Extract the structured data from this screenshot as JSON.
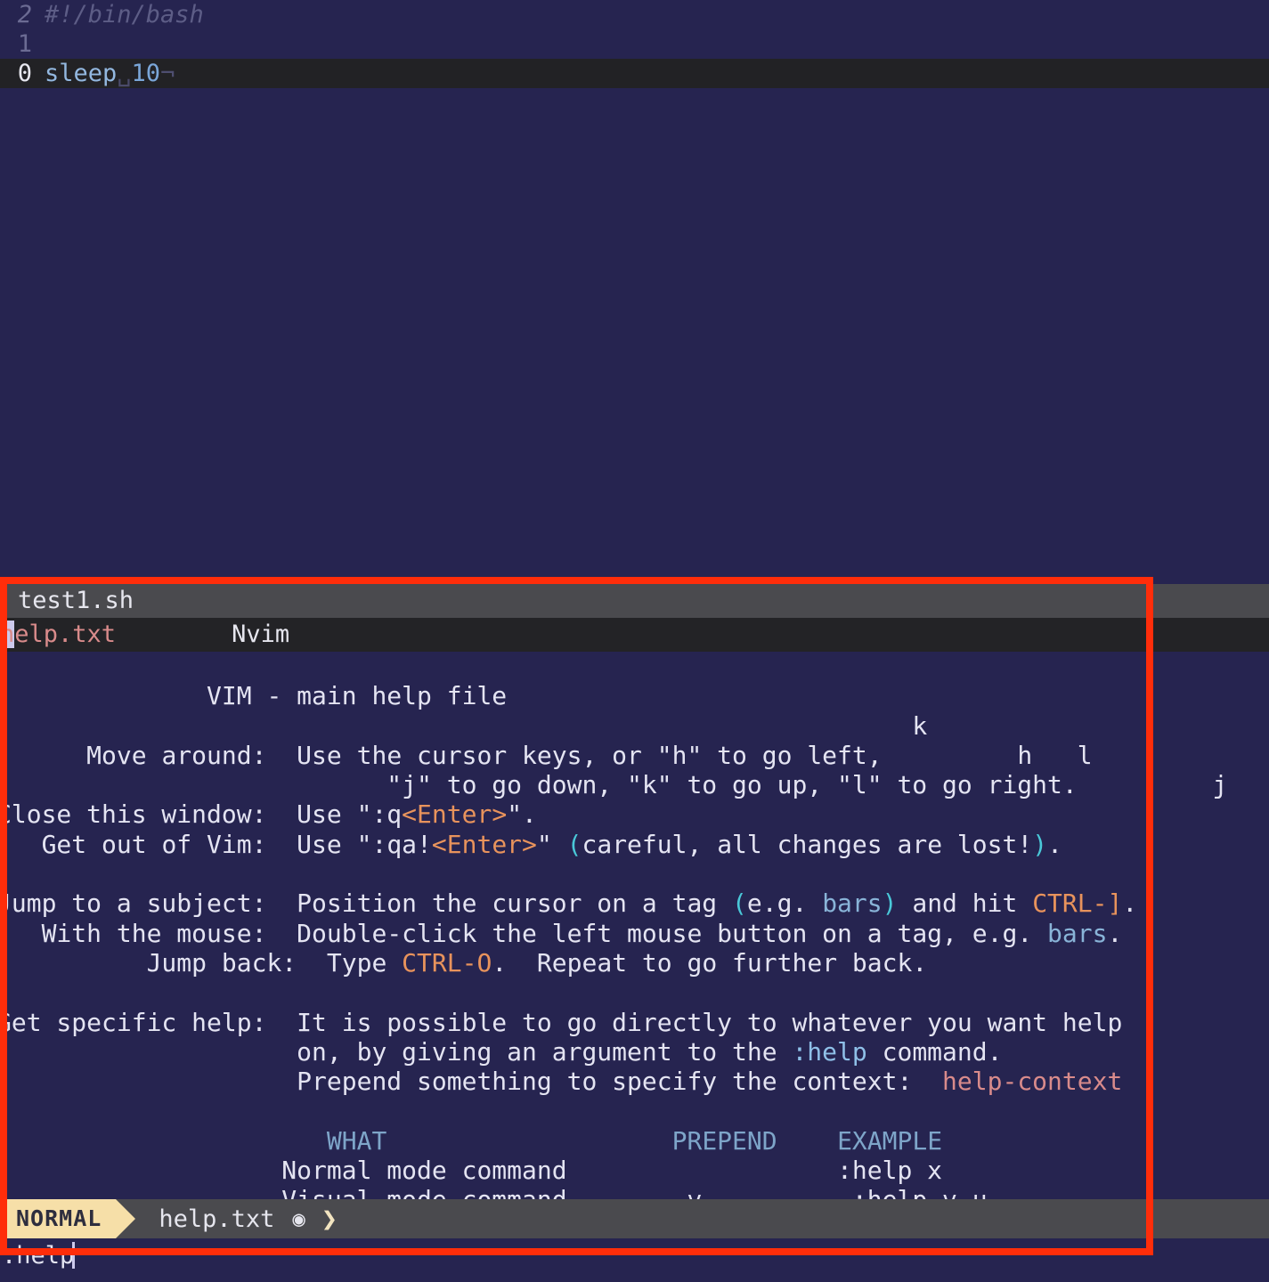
{
  "terminal": {
    "lines": [
      {
        "number": "2",
        "text": "#!/bin/bash",
        "style": "comment"
      },
      {
        "number": "1",
        "text": "",
        "style": "plain"
      },
      {
        "number": "0",
        "text": "sleep 10",
        "style": "current"
      }
    ],
    "current_line_keyword": "sleep",
    "current_line_arg": "10",
    "whitespace_marker": "␣",
    "eol_marker": "¬"
  },
  "tabline": {
    "tab_label": "test1.sh"
  },
  "winbar": {
    "filename": "help.txt",
    "filename_cursor_char": "h",
    "filename_rest": "elp.txt",
    "app_name": "Nvim"
  },
  "help": {
    "title": "VIM - main help file",
    "keydiagram": {
      "up": "k",
      "left": "h",
      "right": "l",
      "down": "j"
    },
    "rows": [
      {
        "label": "Move around:",
        "body": "Use the cursor keys, or \"h\" to go left,"
      },
      {
        "label": "",
        "body": "\"j\" to go down, \"k\" to go up, \"l\" to go right."
      },
      {
        "label": "Close this window:",
        "body_pre": "Use \":q",
        "body_special": "<Enter>",
        "body_post": "\"."
      },
      {
        "label": "Get out of Vim:",
        "body_pre": "Use \":qa!",
        "body_special": "<Enter>",
        "body_post": "\" (careful, all changes are lost!)."
      },
      {
        "label": "Jump to a subject:",
        "body": "Position the cursor on a tag (e.g. bars) and hit CTRL-]."
      },
      {
        "label": "With the mouse:",
        "body": "Double-click the left mouse button on a tag, e.g. bars."
      },
      {
        "label": "Jump back:",
        "body": "Type CTRL-O.  Repeat to go further back."
      },
      {
        "label": "Get specific help:",
        "body": "It is possible to go directly to whatever you want help"
      },
      {
        "label": "",
        "body": "on, by giving an argument to the :help command."
      },
      {
        "label": "",
        "body": "Prepend something to specify the context:  help-context"
      }
    ],
    "fragments": {
      "enter_key": "<Enter>",
      "careful_text": "(careful, all changes are lost!).",
      "tag_bars": "bars",
      "ctrl_bracket": "CTRL-]",
      "ctrl_o": "CTRL-O",
      "help_cmd": ":help",
      "help_context": "help-context"
    },
    "table": {
      "headers": [
        "WHAT",
        "PREPEND",
        "EXAMPLE"
      ],
      "rows": [
        {
          "what": "Normal mode command",
          "prepend": "",
          "example": ":help x"
        },
        {
          "what": "Visual mode command",
          "prepend": "v_",
          "example": ":help v_u"
        }
      ]
    }
  },
  "statusline": {
    "mode": "NORMAL",
    "filename": "help.txt",
    "readonly_icon": "◉",
    "chevron_icon": "❯"
  },
  "cmdline": {
    "text": ":help"
  },
  "colors": {
    "background": "#262450",
    "tabline_bg": "#4a4a4e",
    "winbar_bg": "#232326",
    "highlight_box": "#ff2d0a",
    "mode_badge": "#f6dfa8",
    "tag": "#89b4d8",
    "special": "#e8935c",
    "paren": "#4ac8d8",
    "link": "#d98b8b"
  }
}
